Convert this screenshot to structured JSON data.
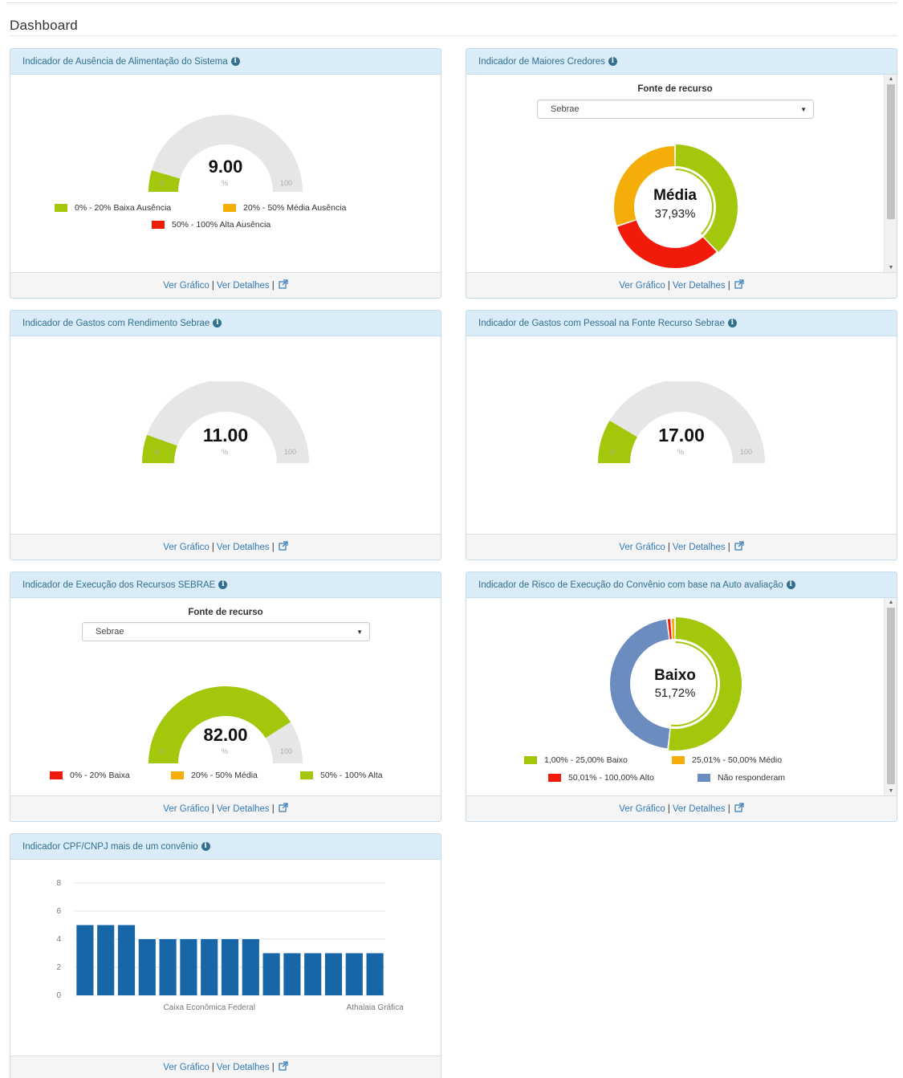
{
  "page": {
    "title": "Dashboard"
  },
  "footer": {
    "grafico": "Ver Gráfico",
    "sep": "|",
    "detalhes": "Ver Detalhes",
    "sep2": "|"
  },
  "colors": {
    "green": "#a3c70a",
    "orange": "#f5ad0a",
    "red": "#f21a0a",
    "blue": "#6b8cbf",
    "track": "#e6e6e6",
    "bar": "#1766a8"
  },
  "panels": {
    "ausencia": {
      "title": "Indicador de Ausência de Alimentação do Sistema",
      "value": 9,
      "value_label": "9.00",
      "min": "0",
      "unit": "%",
      "max": "100",
      "legend": [
        {
          "label": "0% - 20% Baixa Ausência",
          "color": "#a3c70a"
        },
        {
          "label": "20% - 50% Média Ausência",
          "color": "#f5ad0a"
        },
        {
          "label": "50% - 100% Alta Ausência",
          "color": "#f21a0a"
        }
      ]
    },
    "credores": {
      "title": "Indicador de Maiores Credores",
      "select_label": "Fonte de recurso",
      "select_value": "Sebrae",
      "center_title": "Média",
      "center_pct": "37,93%",
      "segments": [
        {
          "name": "green",
          "value": 37.93,
          "color": "#a3c70a"
        },
        {
          "name": "red",
          "value": 32.0,
          "color": "#f21a0a"
        },
        {
          "name": "orange",
          "value": 30.07,
          "color": "#f5ad0a"
        }
      ]
    },
    "rendimento": {
      "title": "Indicador de Gastos com Rendimento Sebrae",
      "value": 11,
      "value_label": "11.00",
      "min": "0",
      "unit": "%",
      "max": "100"
    },
    "pessoal": {
      "title": "Indicador de Gastos com Pessoal na Fonte Recurso Sebrae",
      "value": 17,
      "value_label": "17.00",
      "min": "0",
      "unit": "%",
      "max": "100"
    },
    "execucao": {
      "title": "Indicador de Execução dos Recursos SEBRAE",
      "select_label": "Fonte de recurso",
      "select_value": "Sebrae",
      "value": 82,
      "value_label": "82.00",
      "min": "0",
      "unit": "%",
      "max": "100",
      "legend": [
        {
          "label": "0% - 20% Baixa",
          "color": "#f21a0a"
        },
        {
          "label": "20% - 50% Média",
          "color": "#f5ad0a"
        },
        {
          "label": "50% - 100% Alta",
          "color": "#a3c70a"
        }
      ]
    },
    "risco": {
      "title": "Indicador de Risco de Execução do Convênio com base na Auto avaliação",
      "center_title": "Baixo",
      "center_pct": "51,72%",
      "segments": [
        {
          "name": "Baixo",
          "value": 51.72,
          "color": "#a3c70a"
        },
        {
          "name": "Não responderam",
          "value": 46.28,
          "color": "#6b8cbf"
        },
        {
          "name": "Alto",
          "value": 1.0,
          "color": "#f21a0a"
        },
        {
          "name": "Médio",
          "value": 1.0,
          "color": "#f5ad0a"
        }
      ],
      "legend": [
        {
          "label": "1,00% - 25,00% Baixo",
          "color": "#a3c70a"
        },
        {
          "label": "25,01% - 50,00% Médio",
          "color": "#f5ad0a"
        },
        {
          "label": "50,01% - 100,00% Alto",
          "color": "#f21a0a"
        },
        {
          "label": "Não responderam",
          "color": "#6b8cbf"
        }
      ]
    },
    "cpf": {
      "title": "Indicador CPF/CNPJ mais de um convênio"
    }
  },
  "chart_data": {
    "type": "bar",
    "title": "",
    "xlabel": "",
    "ylabel": "",
    "ylim": [
      0,
      8
    ],
    "yticks": [
      "0",
      "2",
      "4",
      "6",
      "8"
    ],
    "values": [
      5,
      5,
      5,
      4,
      4,
      4,
      4,
      4,
      4,
      3,
      3,
      3,
      3,
      3,
      3
    ],
    "visible_category_labels": [
      {
        "index": 6,
        "label": "Caixa Econômica Federal"
      },
      {
        "index": 14,
        "label": "Athalaia Gráfica"
      }
    ],
    "grid": true,
    "color": "#1766a8"
  }
}
